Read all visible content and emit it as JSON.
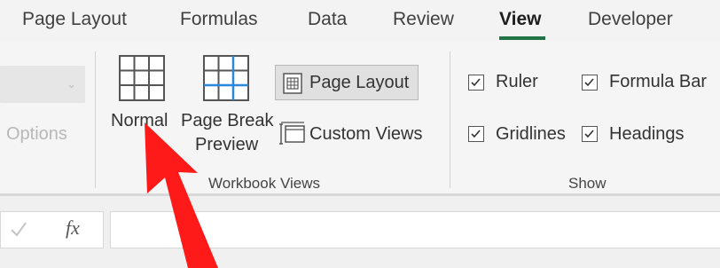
{
  "tabs": [
    {
      "label": "Page Layout",
      "active": false
    },
    {
      "label": "Formulas",
      "active": false
    },
    {
      "label": "Data",
      "active": false
    },
    {
      "label": "Review",
      "active": false
    },
    {
      "label": "View",
      "active": true
    },
    {
      "label": "Developer",
      "active": false
    }
  ],
  "accent_color": "#217346",
  "sheet_view": {
    "options_label": "Options"
  },
  "workbook_views": {
    "group_label": "Workbook Views",
    "normal_label": "Normal",
    "page_break_label_line1": "Page Break",
    "page_break_label_line2": "Preview",
    "page_layout_label": "Page Layout",
    "custom_views_label": "Custom Views"
  },
  "show": {
    "group_label": "Show",
    "ruler": {
      "label": "Ruler",
      "checked": true
    },
    "formula_bar": {
      "label": "Formula Bar",
      "checked": true
    },
    "gridlines": {
      "label": "Gridlines",
      "checked": true
    },
    "headings": {
      "label": "Headings",
      "checked": true
    }
  },
  "formula_bar": {
    "fx_label": "fx",
    "value": ""
  },
  "annotation": {
    "arrow_color": "#ff1a1a"
  }
}
